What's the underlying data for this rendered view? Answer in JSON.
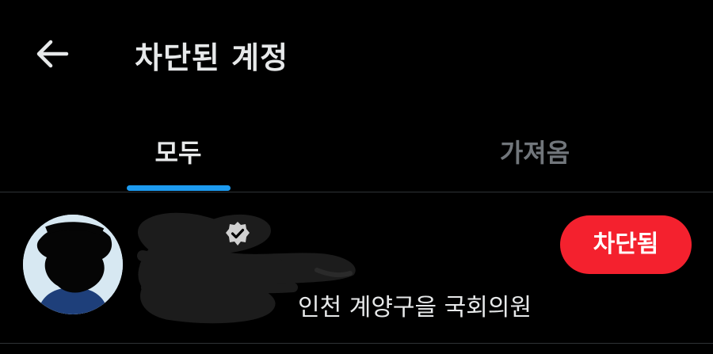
{
  "header": {
    "back_icon": "arrow-left-icon",
    "title": "차단된 계정"
  },
  "tabs": [
    {
      "label": "모두",
      "active": true
    },
    {
      "label": "가져옴",
      "active": false
    }
  ],
  "accent_color": "#1d9bf0",
  "accounts": [
    {
      "avatar_icon": "avatar-redacted",
      "verified_icon": "verified-badge-icon",
      "bio": "인천 계양구을 국회의원",
      "action_label": "차단됨",
      "action_color": "#f4212e"
    }
  ]
}
